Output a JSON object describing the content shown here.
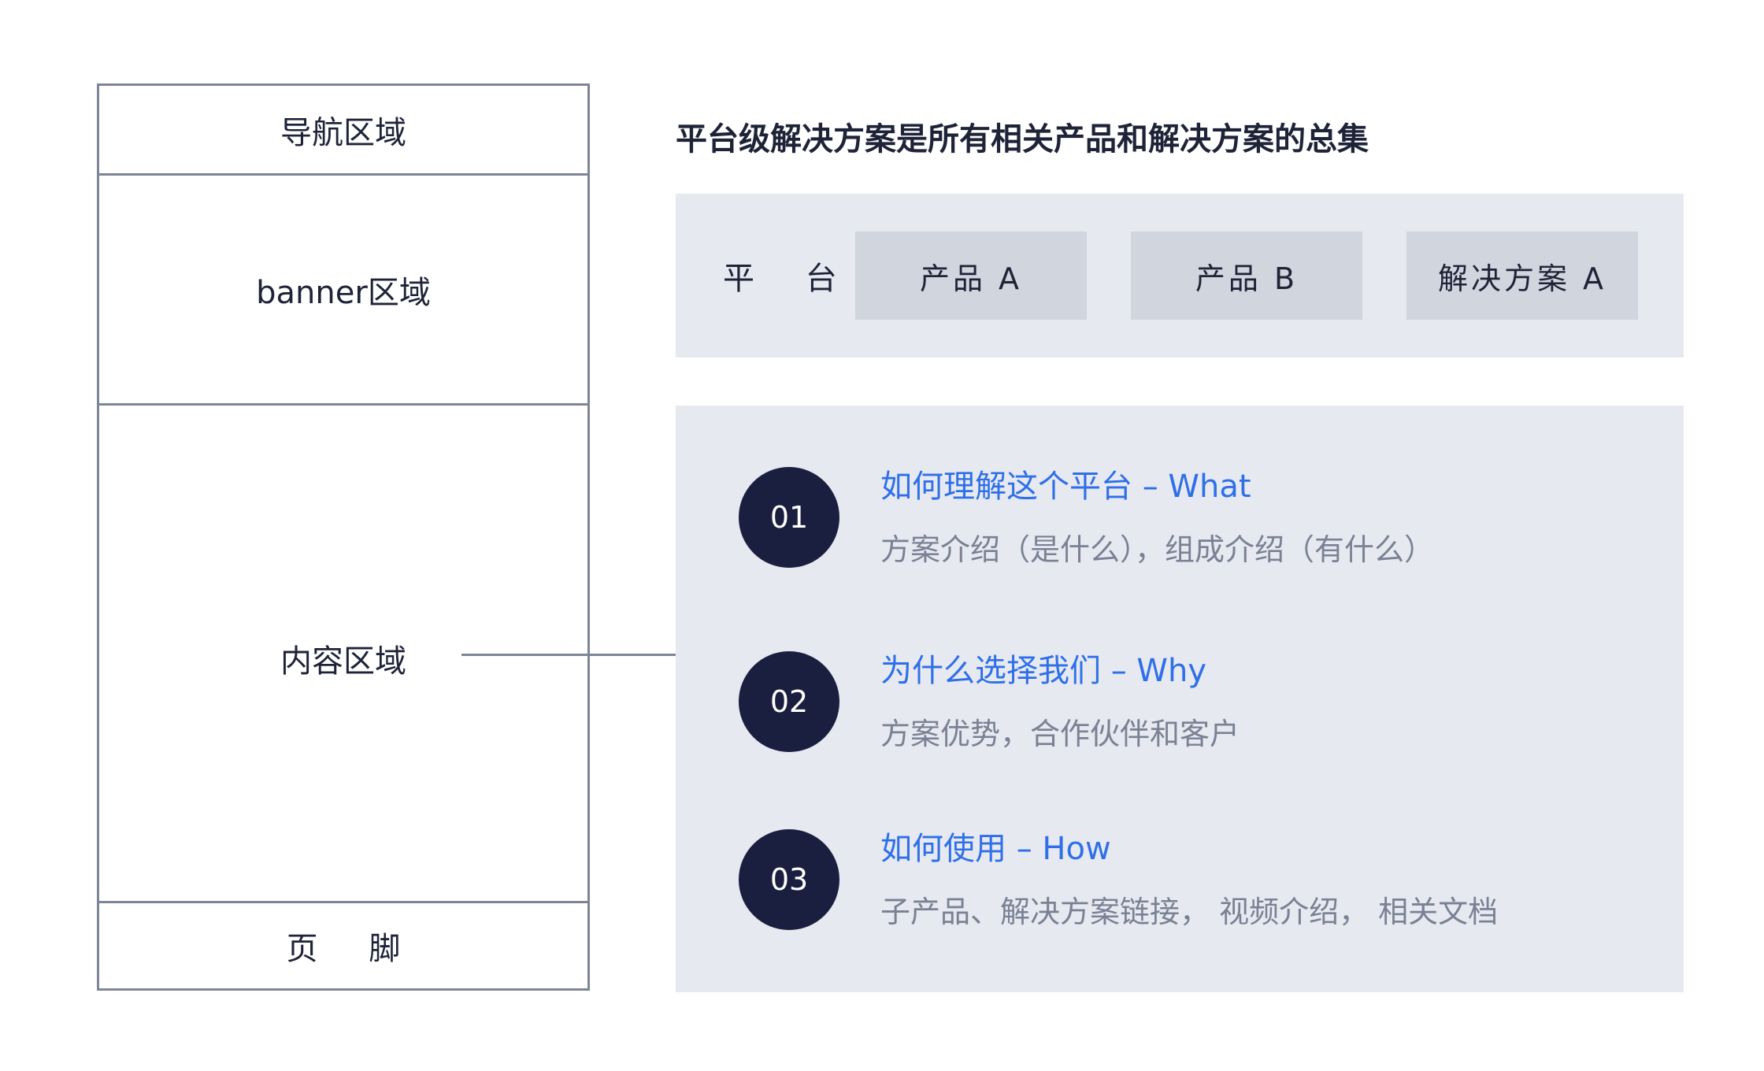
{
  "wireframe": {
    "nav_label": "导航区域",
    "banner_label": "banner区域",
    "content_label": "内容区域",
    "footer_label": "页 脚"
  },
  "headline": "平台级解决方案是所有相关产品和解决方案的总集",
  "platform": {
    "label": "平 台",
    "chips": [
      "产品 A",
      "产品 B",
      "解决方案 A"
    ]
  },
  "items": [
    {
      "number": "01",
      "title": "如何理解这个平台 – What",
      "description": "方案介绍（是什么），组成介绍（有什么）"
    },
    {
      "number": "02",
      "title": "为什么选择我们 – Why",
      "description": "方案优势，合作伙伴和客户"
    },
    {
      "number": "03",
      "title": "如何使用 – How",
      "description": "子产品、解决方案链接， 视频介绍， 相关文档"
    }
  ],
  "colors": {
    "dark_navy": "#1b1f3f",
    "accent_blue": "#2f6fe8",
    "panel_bg": "#e6e9f0",
    "chip_bg": "#d0d5de",
    "border_gray": "#7e8596",
    "muted_text": "#7a8194"
  }
}
